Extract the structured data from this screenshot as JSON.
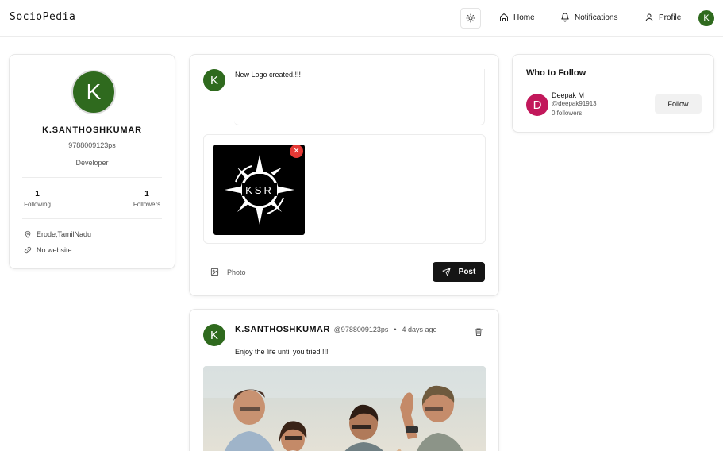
{
  "header": {
    "logo": "SocioPedia",
    "nav": {
      "home": "Home",
      "notifications": "Notifications",
      "profile": "Profile"
    },
    "avatar_initial": "K"
  },
  "profile": {
    "initial": "K",
    "name": "K.SANTHOSHKUMAR",
    "handle": "9788009123ps",
    "role": "Developer",
    "following_count": "1",
    "following_label": "Following",
    "followers_count": "1",
    "followers_label": "Followers",
    "location": "Erode,TamilNadu",
    "website": "No website"
  },
  "composer": {
    "avatar_initial": "K",
    "text": "New Logo created.!!!",
    "remove_symbol": "✕",
    "logo_text": "KSR",
    "photo_label": "Photo",
    "post_label": "Post"
  },
  "post": {
    "avatar_initial": "K",
    "author": "K.SANTHOSHKUMAR",
    "handle": "@9788009123ps",
    "separator": "•",
    "time": "4 days ago",
    "text": "Enjoy the life until you tried !!!"
  },
  "who_to_follow": {
    "title": "Who to Follow",
    "suggestions": [
      {
        "initial": "D",
        "name": "Deepak M",
        "handle": "@deepak91913",
        "followers": "0 followers",
        "button": "Follow"
      }
    ]
  },
  "colors": {
    "avatar_green": "#2f6a1e",
    "avatar_pink": "#c2185b",
    "remove_red": "#e53935",
    "post_button": "#151515"
  }
}
